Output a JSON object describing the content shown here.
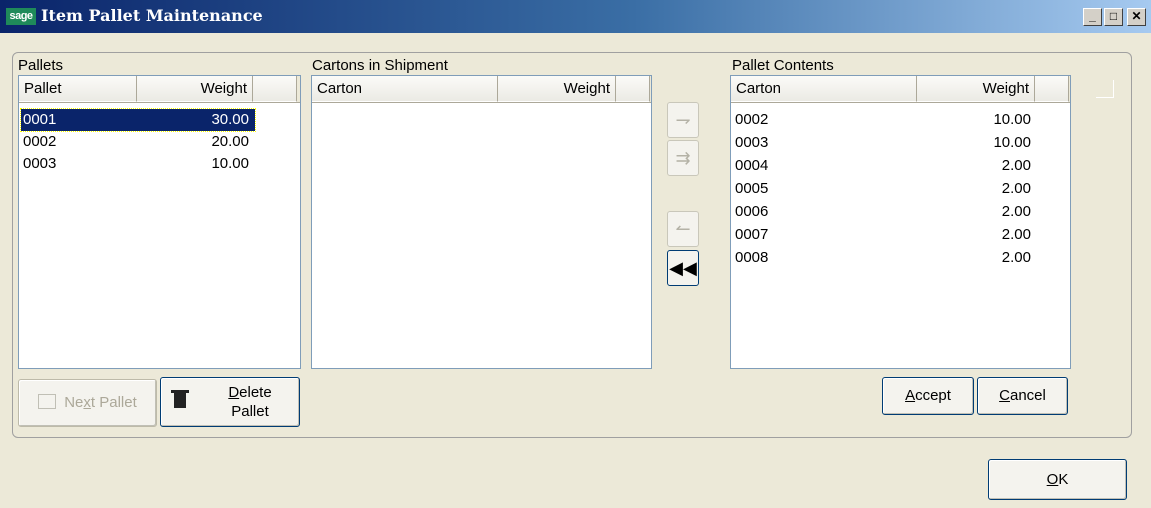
{
  "window": {
    "title": "Item Pallet Maintenance",
    "logo": "sage"
  },
  "pallets": {
    "label": "Pallets",
    "columns": [
      "Pallet",
      "Weight"
    ],
    "rows": [
      {
        "id": "0001",
        "weight": "30.00"
      },
      {
        "id": "0002",
        "weight": "20.00"
      },
      {
        "id": "0003",
        "weight": "10.00"
      }
    ]
  },
  "cartons": {
    "label": "Cartons in Shipment",
    "columns": [
      "Carton",
      "Weight"
    ]
  },
  "contents": {
    "label": "Pallet Contents",
    "columns": [
      "Carton",
      "Weight"
    ],
    "rows": [
      {
        "id": "0002",
        "weight": "10.00"
      },
      {
        "id": "0003",
        "weight": "10.00"
      },
      {
        "id": "0004",
        "weight": "2.00"
      },
      {
        "id": "0005",
        "weight": "2.00"
      },
      {
        "id": "0006",
        "weight": "2.00"
      },
      {
        "id": "0007",
        "weight": "2.00"
      },
      {
        "id": "0008",
        "weight": "2.00"
      }
    ]
  },
  "buttons": {
    "next_pallet_a": "Ne",
    "next_pallet_key": "x",
    "next_pallet_b": "t Pallet",
    "delete_key": "D",
    "delete_a": "elete",
    "delete_b": "Pallet",
    "accept_key": "A",
    "accept_rest": "ccept",
    "cancel_key": "C",
    "cancel_rest": "ancel",
    "ok_key": "O",
    "ok_rest": "K"
  }
}
